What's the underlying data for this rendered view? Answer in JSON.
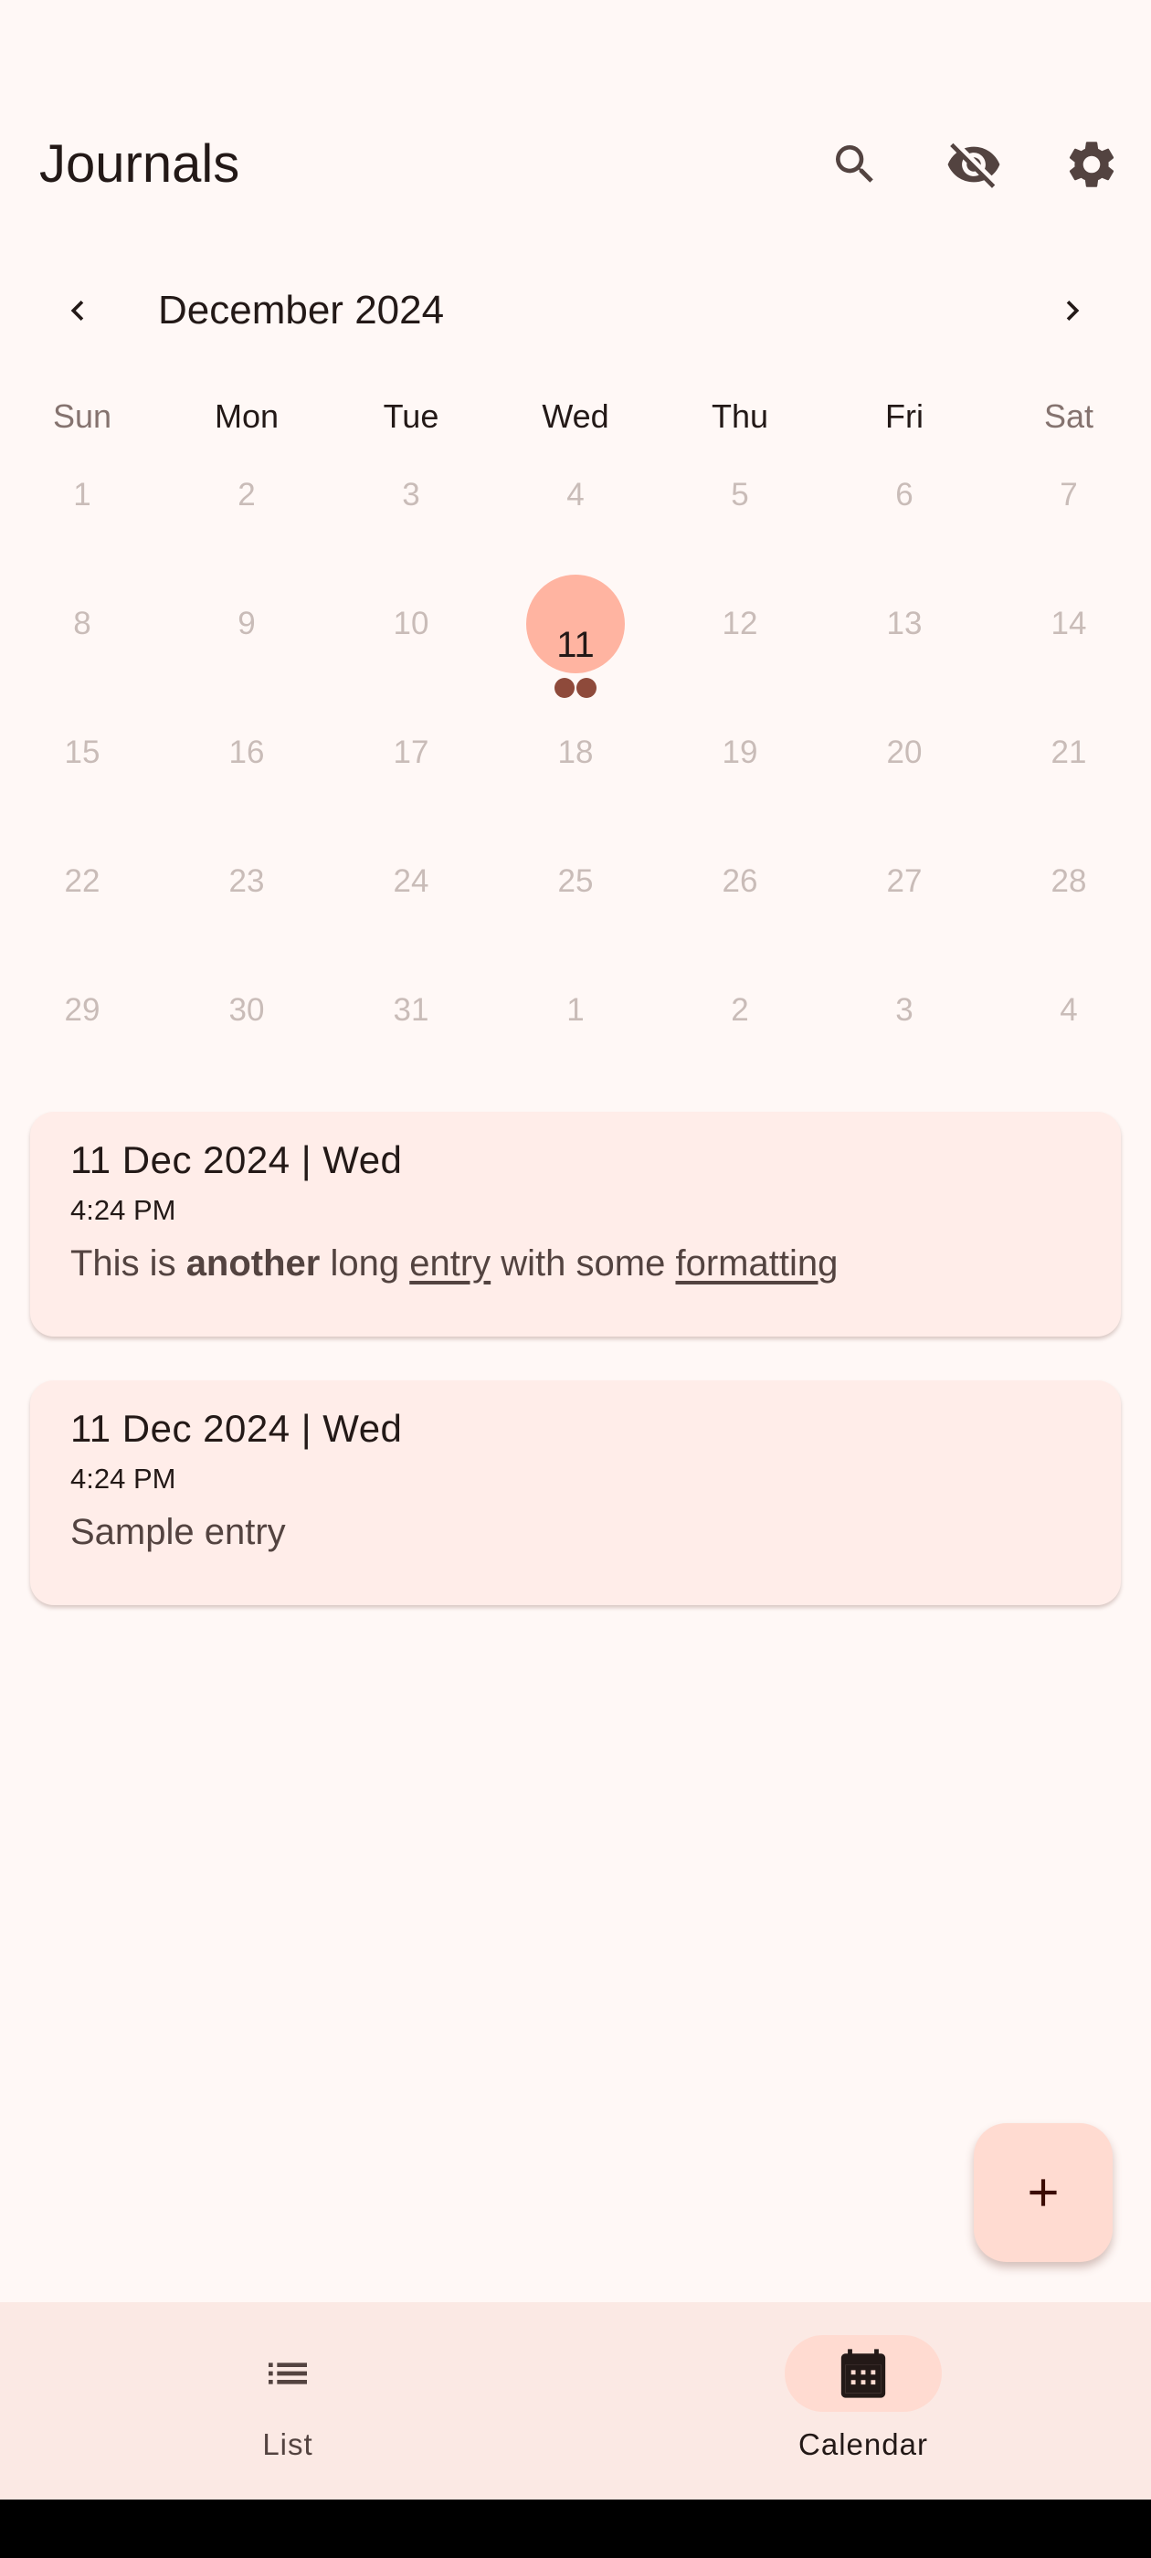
{
  "app_bar": {
    "title": "Journals",
    "icons": [
      "search-icon",
      "visibility-off-icon",
      "settings-icon"
    ]
  },
  "calendar": {
    "month_label": "December 2024",
    "weekdays": [
      "Sun",
      "Mon",
      "Tue",
      "Wed",
      "Thu",
      "Fri",
      "Sat"
    ],
    "weeks": [
      [
        "1",
        "2",
        "3",
        "4",
        "5",
        "6",
        "7"
      ],
      [
        "8",
        "9",
        "10",
        "11",
        "12",
        "13",
        "14"
      ],
      [
        "15",
        "16",
        "17",
        "18",
        "19",
        "20",
        "21"
      ],
      [
        "22",
        "23",
        "24",
        "25",
        "26",
        "27",
        "28"
      ],
      [
        "29",
        "30",
        "31",
        "1",
        "2",
        "3",
        "4"
      ]
    ],
    "selected_day": "11",
    "selected_day_entry_count": 2
  },
  "entries": [
    {
      "date": "11 Dec 2024 | Wed",
      "time": "4:24 PM",
      "body_parts": [
        "This is ",
        "another",
        " long ",
        "entry",
        " with some ",
        "formatting"
      ]
    },
    {
      "date": "11 Dec 2024 | Wed",
      "time": "4:24 PM",
      "body": "Sample entry"
    }
  ],
  "fab": {
    "icon": "add-icon"
  },
  "bottom_nav": {
    "items": [
      {
        "label": "List",
        "icon": "list-icon",
        "active": false
      },
      {
        "label": "Calendar",
        "icon": "calendar-icon",
        "active": true
      }
    ]
  },
  "colors": {
    "background": "#fff8f6",
    "card": "#ffede9",
    "selected_day": "#ffb4a1",
    "entry_marker": "#8e4a3b",
    "fab": "#ffdbd1",
    "nav_bar": "#fbe9e4"
  }
}
